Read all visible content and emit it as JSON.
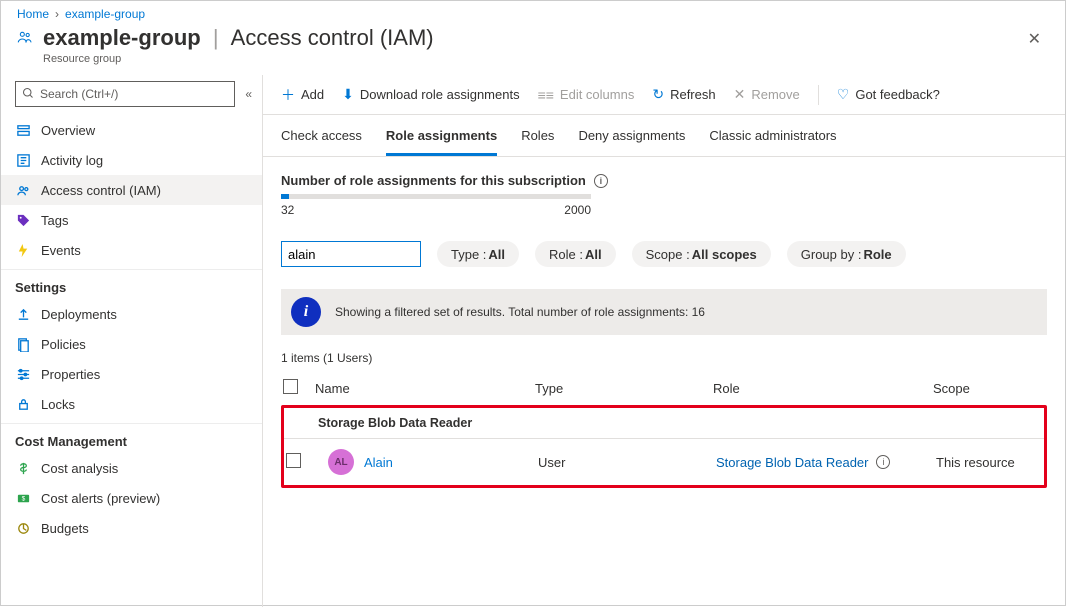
{
  "breadcrumb": {
    "home": "Home",
    "group": "example-group"
  },
  "header": {
    "title": "example-group",
    "page": "Access control (IAM)",
    "subtitle": "Resource group"
  },
  "search": {
    "placeholder": "Search (Ctrl+/)"
  },
  "sidebar": {
    "items": [
      {
        "label": "Overview",
        "icon": "overview-icon",
        "color": "#0078d4"
      },
      {
        "label": "Activity log",
        "icon": "log-icon",
        "color": "#0078d4"
      },
      {
        "label": "Access control (IAM)",
        "icon": "people-icon",
        "color": "#0078d4",
        "active": true
      },
      {
        "label": "Tags",
        "icon": "tag-icon",
        "color": "#6b2fbf"
      },
      {
        "label": "Events",
        "icon": "events-icon",
        "color": "#f2c811"
      }
    ],
    "sections": [
      {
        "title": "Settings",
        "items": [
          {
            "label": "Deployments",
            "icon": "upload-icon",
            "color": "#0078d4"
          },
          {
            "label": "Policies",
            "icon": "policy-icon",
            "color": "#0078d4"
          },
          {
            "label": "Properties",
            "icon": "props-icon",
            "color": "#0078d4"
          },
          {
            "label": "Locks",
            "icon": "lock-icon",
            "color": "#0078d4"
          }
        ]
      },
      {
        "title": "Cost Management",
        "items": [
          {
            "label": "Cost analysis",
            "icon": "cost-icon",
            "color": "#2da44e"
          },
          {
            "label": "Cost alerts (preview)",
            "icon": "alert-icon",
            "color": "#2da44e"
          },
          {
            "label": "Budgets",
            "icon": "budget-icon",
            "color": "#9b870c"
          }
        ]
      }
    ]
  },
  "toolbar": {
    "add": "Add",
    "download": "Download role assignments",
    "edit": "Edit columns",
    "refresh": "Refresh",
    "remove": "Remove",
    "feedback": "Got feedback?"
  },
  "tabs": {
    "check": "Check access",
    "assign": "Role assignments",
    "roles": "Roles",
    "deny": "Deny assignments",
    "classic": "Classic administrators"
  },
  "stats": {
    "title": "Number of role assignments for this subscription",
    "current": "32",
    "max": "2000"
  },
  "filters": {
    "searchValue": "alain",
    "type": {
      "label": "Type : ",
      "value": "All"
    },
    "role": {
      "label": "Role : ",
      "value": "All"
    },
    "scope": {
      "label": "Scope : ",
      "value": "All scopes"
    },
    "group": {
      "label": "Group by : ",
      "value": "Role"
    }
  },
  "banner": {
    "text": "Showing a filtered set of results. Total number of role assignments: 16"
  },
  "summary": "1 items (1 Users)",
  "columns": {
    "name": "Name",
    "type": "Type",
    "role": "Role",
    "scope": "Scope"
  },
  "group": {
    "label": "Storage Blob Data Reader"
  },
  "row": {
    "initials": "AL",
    "name": "Alain",
    "type": "User",
    "role": "Storage Blob Data Reader",
    "scope": "This resource"
  }
}
